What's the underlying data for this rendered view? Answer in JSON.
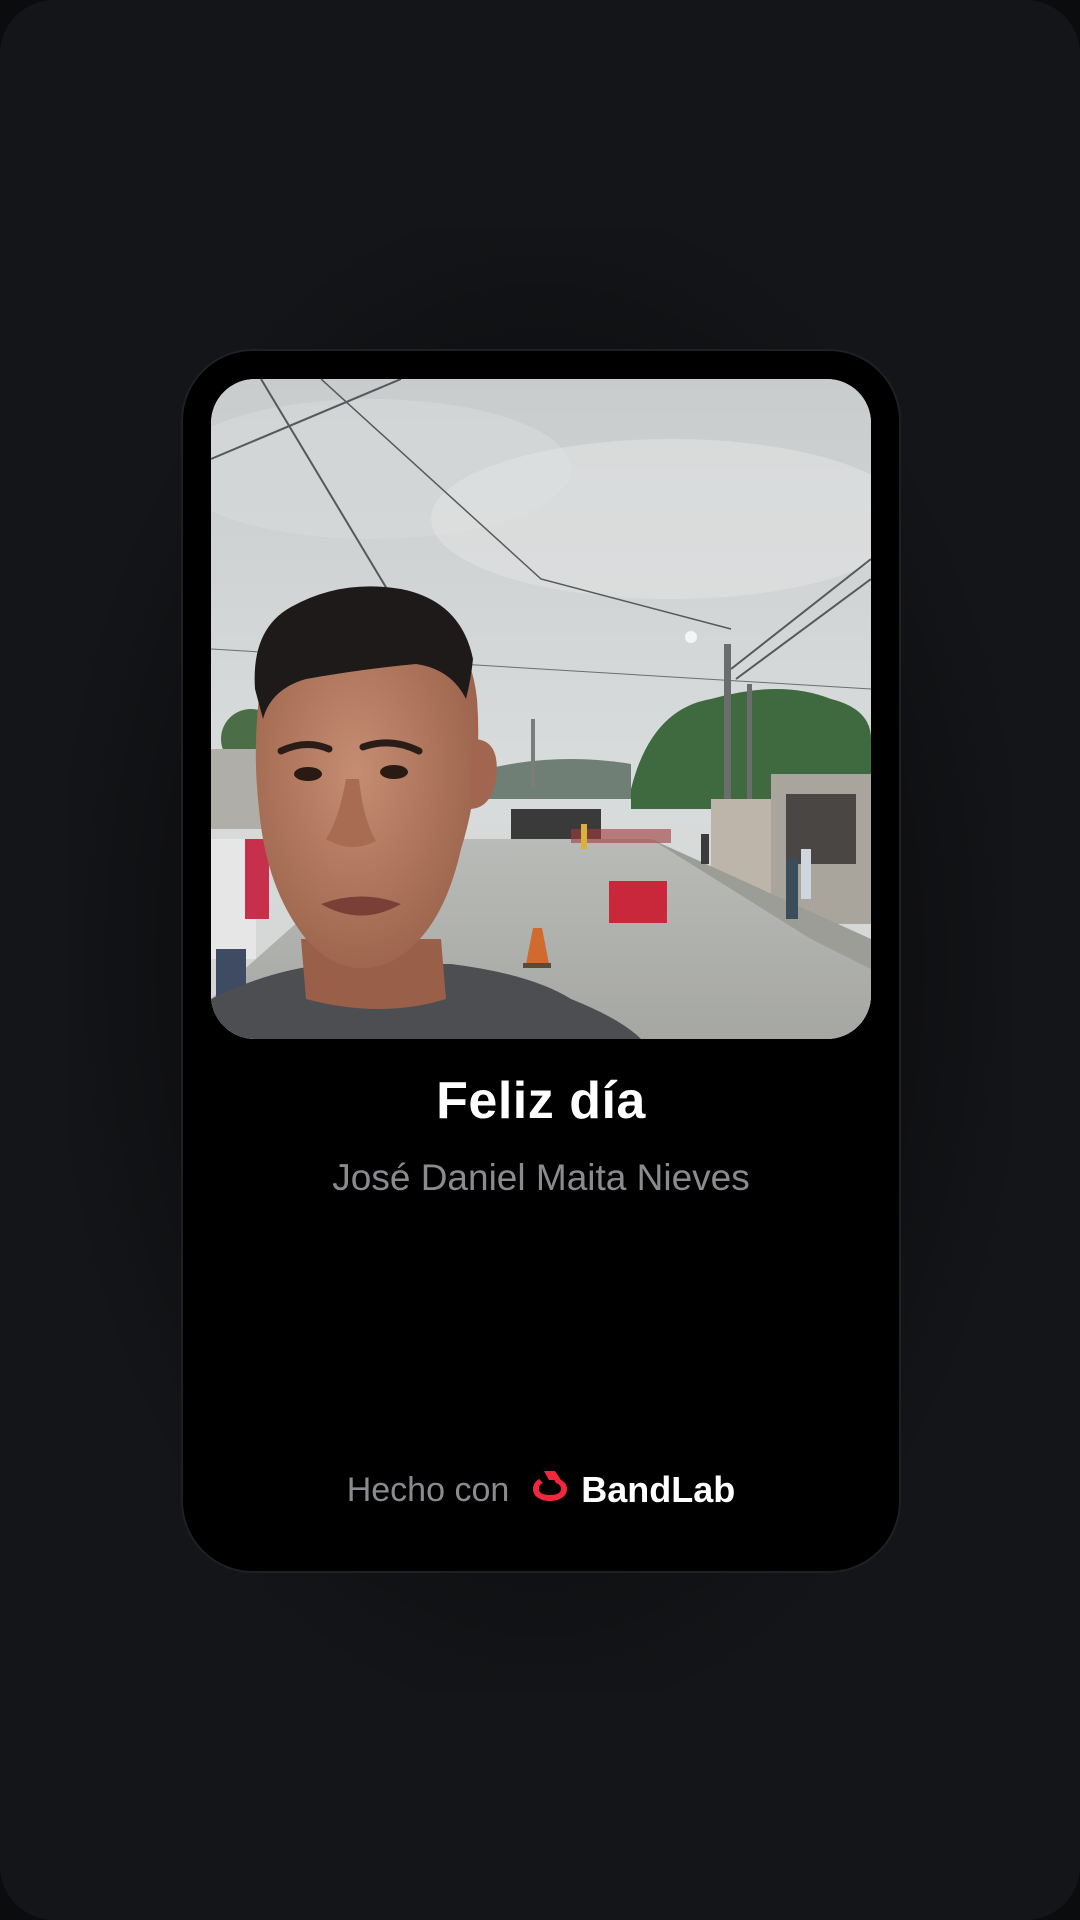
{
  "card": {
    "title": "Feliz día",
    "subtitle": "José Daniel Maita Nieves",
    "made_with_label": "Hecho con",
    "brand_name": "BandLab"
  },
  "icons": {
    "brand_logo": "bandlab-logo-icon"
  },
  "colors": {
    "background": "#141518",
    "card": "#000000",
    "title": "#ffffff",
    "muted_text": "#8a8b8e",
    "brand_red": "#f2273c"
  }
}
